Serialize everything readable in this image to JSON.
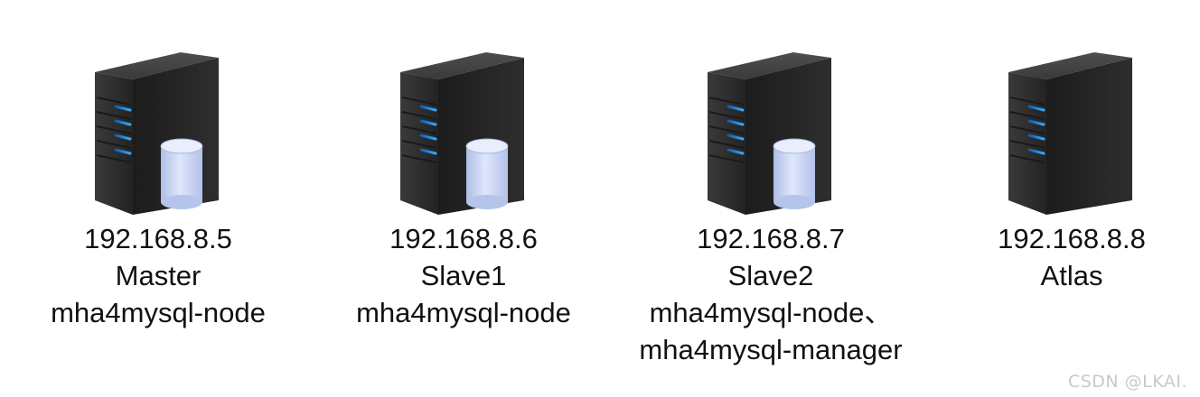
{
  "nodes": [
    {
      "icon": "server-database-icon",
      "ip": "192.168.8.5",
      "role": "Master",
      "software": [
        "mha4mysql-node"
      ]
    },
    {
      "icon": "server-database-icon",
      "ip": "192.168.8.6",
      "role": "Slave1",
      "software": [
        "mha4mysql-node"
      ]
    },
    {
      "icon": "server-database-icon",
      "ip": "192.168.8.7",
      "role": "Slave2",
      "software": [
        "mha4mysql-node、",
        "mha4mysql-manager"
      ]
    },
    {
      "icon": "server-icon",
      "ip": "192.168.8.8",
      "role": "Atlas",
      "software": []
    }
  ],
  "watermark": "CSDN @LKAI.",
  "colors": {
    "server_dark": "#2b2b2b",
    "server_light": "#454545",
    "led": "#1e90e8",
    "database": "#c9d6f2"
  }
}
